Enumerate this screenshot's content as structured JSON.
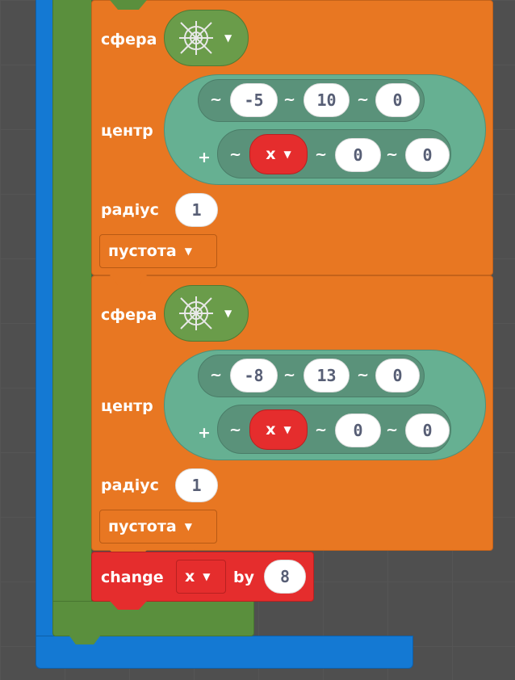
{
  "blocks": [
    {
      "label": "сфера",
      "material_icon": "cobweb-icon",
      "center_label": "центр",
      "row1": {
        "x": "-5",
        "y": "10",
        "z": "0"
      },
      "row2": {
        "plus": "+",
        "var": "x",
        "y": "0",
        "z": "0"
      },
      "radius_label": "радіус",
      "radius": "1",
      "fill": "пустота"
    },
    {
      "label": "сфера",
      "material_icon": "cobweb-icon",
      "center_label": "центр",
      "row1": {
        "x": "-8",
        "y": "13",
        "z": "0"
      },
      "row2": {
        "plus": "+",
        "var": "x",
        "y": "0",
        "z": "0"
      },
      "radius_label": "радіус",
      "radius": "1",
      "fill": "пустота"
    }
  ],
  "tilde": "~",
  "change": {
    "label": "change",
    "var": "x",
    "by": "by",
    "value": "8"
  },
  "colors": {
    "loop": "#1479d3",
    "inner": "#5a8f3d",
    "block": "#e87722",
    "variable": "#e52d2d",
    "position": "#66b092"
  }
}
